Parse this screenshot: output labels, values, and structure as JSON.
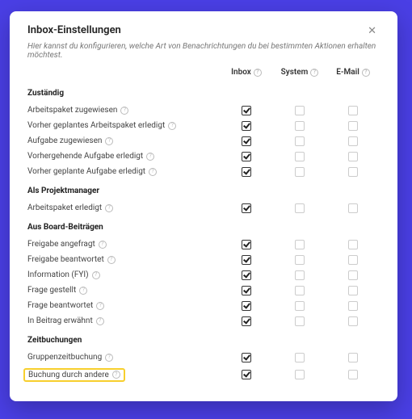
{
  "header": {
    "title": "Inbox-Einstellungen",
    "subtitle": "Hier kannst du konfigurieren, welche Art von Benachrichtungen du bei bestimmten Aktionen erhalten möchtest."
  },
  "columns": [
    "Inbox",
    "System",
    "E-Mail"
  ],
  "sections": [
    {
      "title": "Zuständig",
      "rows": [
        {
          "label": "Arbeitspaket zugewiesen",
          "checked": [
            true,
            false,
            false
          ]
        },
        {
          "label": "Vorher geplantes Arbeitspaket erledigt",
          "checked": [
            true,
            false,
            false
          ]
        },
        {
          "label": "Aufgabe zugewiesen",
          "checked": [
            true,
            false,
            false
          ]
        },
        {
          "label": "Vorhergehende Aufgabe erledigt",
          "checked": [
            true,
            false,
            false
          ]
        },
        {
          "label": "Vorher geplante Aufgabe erledigt",
          "checked": [
            true,
            false,
            false
          ]
        }
      ]
    },
    {
      "title": "Als Projektmanager",
      "rows": [
        {
          "label": "Arbeitspaket erledigt",
          "checked": [
            true,
            false,
            false
          ]
        }
      ]
    },
    {
      "title": "Aus Board-Beiträgen",
      "rows": [
        {
          "label": "Freigabe angefragt",
          "checked": [
            true,
            false,
            false
          ]
        },
        {
          "label": "Freigabe beantwortet",
          "checked": [
            true,
            false,
            false
          ]
        },
        {
          "label": "Information (FYI)",
          "checked": [
            true,
            false,
            false
          ]
        },
        {
          "label": "Frage gestellt",
          "checked": [
            true,
            false,
            false
          ]
        },
        {
          "label": "Frage beantwortet",
          "checked": [
            true,
            false,
            false
          ]
        },
        {
          "label": "In Beitrag erwähnt",
          "checked": [
            true,
            false,
            false
          ]
        }
      ]
    },
    {
      "title": "Zeitbuchungen",
      "rows": [
        {
          "label": "Gruppenzeitbuchung",
          "checked": [
            true,
            false,
            false
          ]
        },
        {
          "label": "Buchung durch andere",
          "checked": [
            true,
            false,
            false
          ],
          "highlight": true
        }
      ]
    }
  ]
}
